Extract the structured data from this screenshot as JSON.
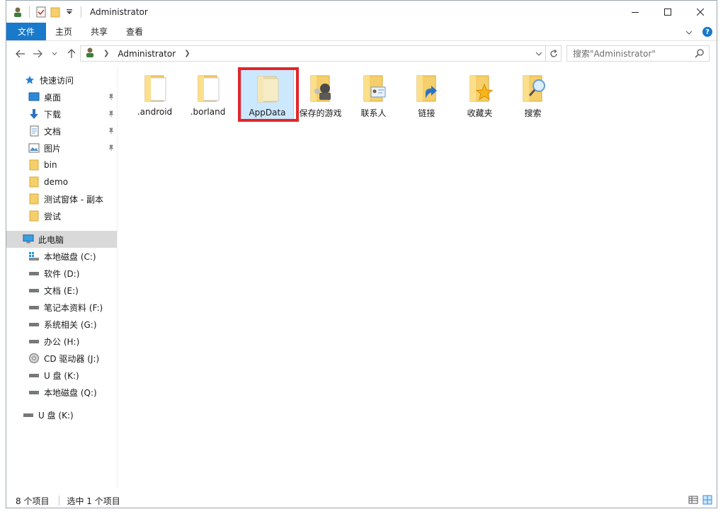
{
  "window": {
    "title": "Administrator"
  },
  "ribbon": {
    "file_tab": "文件",
    "tabs": [
      "主页",
      "共享",
      "查看"
    ]
  },
  "address": {
    "crumb": "Administrator"
  },
  "search": {
    "placeholder": "搜索\"Administrator\""
  },
  "nav": {
    "quick_access": "快速访问",
    "pinned": [
      "桌面",
      "下载",
      "文档",
      "图片"
    ],
    "folders": [
      "bin",
      "demo",
      "测试窗体 - 副本",
      "尝试"
    ],
    "this_pc": "此电脑",
    "drives": [
      "本地磁盘 (C:)",
      "软件 (D:)",
      "文档 (E:)",
      "笔记本资料 (F:)",
      "系统相关 (G:)",
      "办公 (H:)",
      "CD 驱动器 (J:)",
      "U 盘 (K:)",
      "本地磁盘 (Q:)"
    ],
    "usb": "U 盘 (K:)"
  },
  "content": {
    "items": [
      ".android",
      ".borland",
      "AppData",
      "保存的游戏",
      "联系人",
      "链接",
      "收藏夹",
      "搜索"
    ],
    "selected": "AppData"
  },
  "status": {
    "count": "8 个项目",
    "selection": "选中 1 个项目"
  },
  "colors": {
    "accent": "#1979ca",
    "selection_bg": "#cce8ff",
    "highlight": "#e0262a",
    "folder": "#f5cf6b"
  }
}
